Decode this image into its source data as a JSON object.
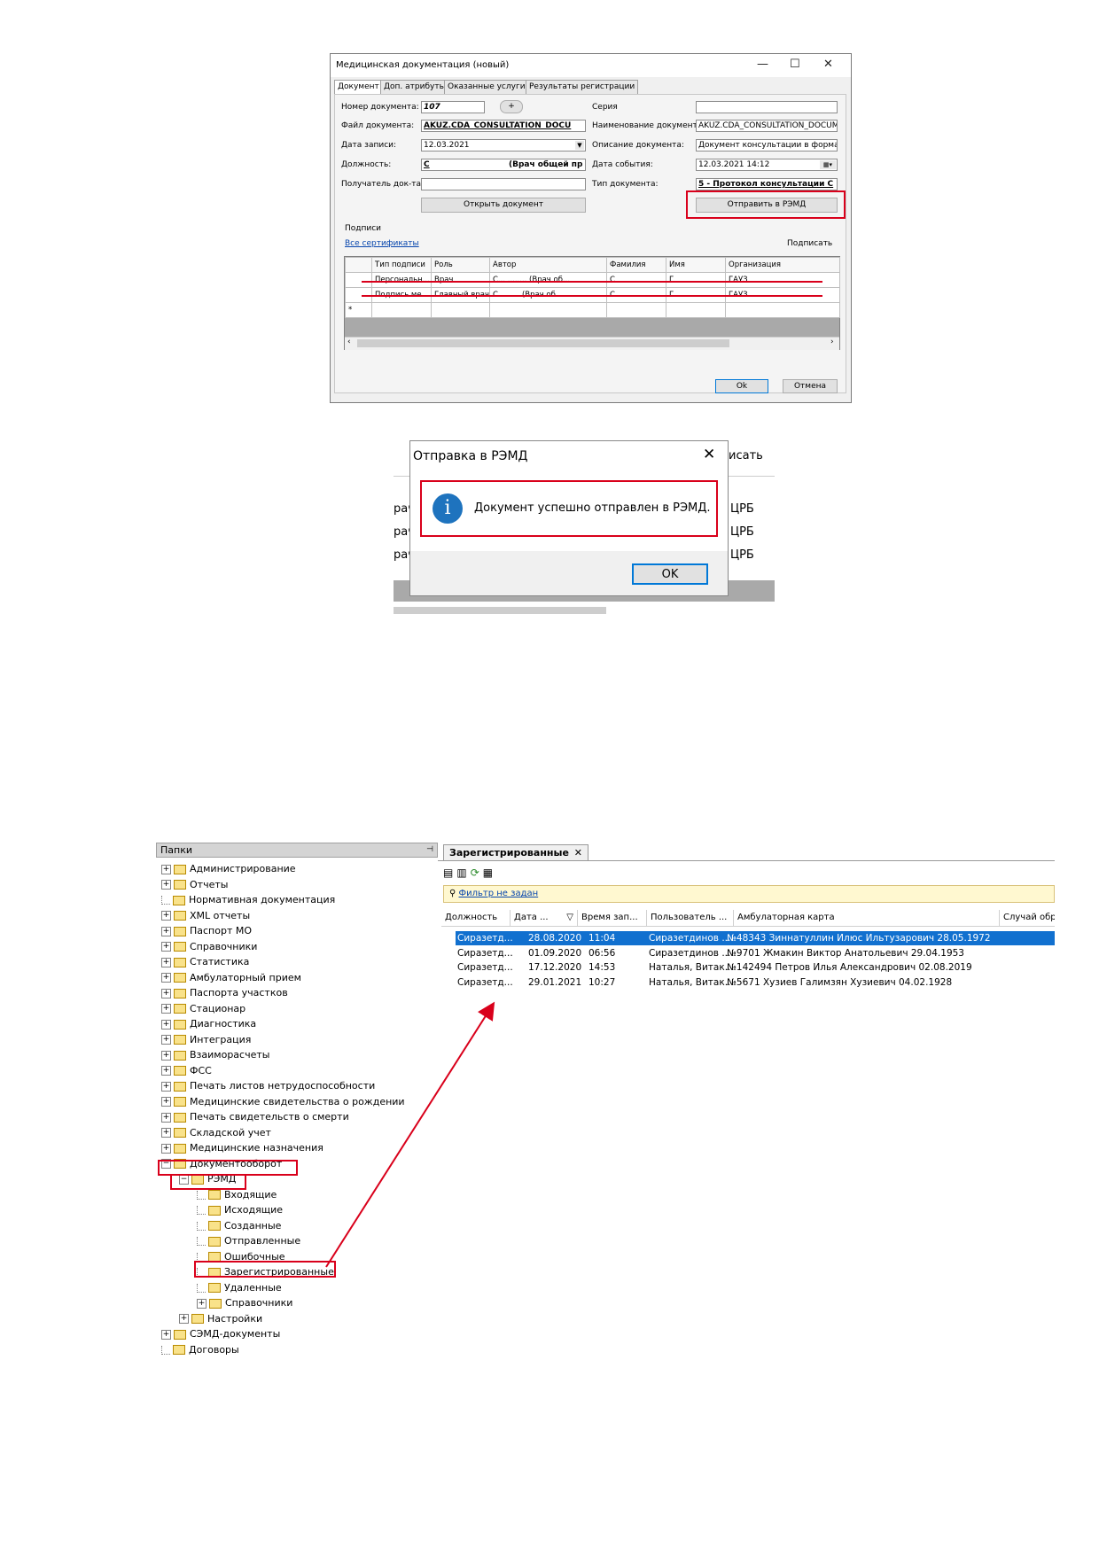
{
  "dialog1": {
    "title": "Медицинская документация (новый)",
    "tabs": [
      "Документ",
      "Доп. атрибуты",
      "Оказанные услуги",
      "Результаты регистрации"
    ],
    "labels": {
      "doc_number": "Номер документа:",
      "series": "Серия",
      "doc_file": "Файл документа:",
      "doc_name": "Наименование документа:",
      "record_date": "Дата записи:",
      "doc_description": "Описание документа:",
      "position": "Должность:",
      "event_date": "Дата события:",
      "recipient": "Получатель док-та",
      "doc_type": "Тип документа:",
      "signatures": "Подписи"
    },
    "values": {
      "doc_number": "107",
      "plus": "+",
      "doc_file": "AKUZ.CDA_CONSULTATION_DOCU",
      "doc_name": "AKUZ.CDA_CONSULTATION_DOCUM",
      "record_date": "12.03.2021",
      "doc_description": "Документ консультации в формате (",
      "position_prefix": "С",
      "position": "(Врач общей пр",
      "event_date": "12.03.2021 14:12",
      "doc_type": "5 - Протокол консультации С"
    },
    "buttons": {
      "open_doc": "Открыть документ",
      "send_remd": "Отправить в РЭМД",
      "ok": "Ok",
      "cancel": "Отмена"
    },
    "links": {
      "all_certs": "Все сертификаты",
      "sign": "Подписать"
    },
    "grid": {
      "headers": [
        "Тип подписи",
        "Роль",
        "Автор",
        "Фамилия",
        "Имя",
        "Организация"
      ],
      "rows": [
        [
          "Персональн...",
          "Врач",
          "С...  ........ (Врач об...",
          "С",
          "Г",
          "ГАУЗ"
        ],
        [
          "Подпись ме...",
          "Главный врач",
          "С ........ (Врач об...",
          "С",
          "Г",
          "ГАУЗ"
        ]
      ],
      "new_row_marker": "*"
    }
  },
  "dialog2": {
    "title": "Отправка в РЭМД",
    "message": "Документ успешно отправлен в РЭМД.",
    "ok": "OK",
    "bg_fragments": [
      "исать",
      "рач",
      "рач",
      "рач",
      "ЦРБ",
      "ЦРБ",
      "ЦРБ"
    ]
  },
  "tree": {
    "header": "Папки",
    "pin": "📌",
    "nodes": [
      {
        "label": "Администрирование",
        "level": 0,
        "exp": "+"
      },
      {
        "label": "Отчеты",
        "level": 0,
        "exp": "+"
      },
      {
        "label": "Нормативная документация",
        "level": 0,
        "exp": ""
      },
      {
        "label": "XML отчеты",
        "level": 0,
        "exp": "+"
      },
      {
        "label": "Паспорт МО",
        "level": 0,
        "exp": "+"
      },
      {
        "label": "Справочники",
        "level": 0,
        "exp": "+"
      },
      {
        "label": "Статистика",
        "level": 0,
        "exp": "+"
      },
      {
        "label": "Амбулаторный прием",
        "level": 0,
        "exp": "+"
      },
      {
        "label": "Паспорта участков",
        "level": 0,
        "exp": "+"
      },
      {
        "label": "Стационар",
        "level": 0,
        "exp": "+"
      },
      {
        "label": "Диагностика",
        "level": 0,
        "exp": "+"
      },
      {
        "label": "Интеграция",
        "level": 0,
        "exp": "+"
      },
      {
        "label": "Взаиморасчеты",
        "level": 0,
        "exp": "+"
      },
      {
        "label": "ФСС",
        "level": 0,
        "exp": "+"
      },
      {
        "label": "Печать листов нетрудоспособности",
        "level": 0,
        "exp": "+"
      },
      {
        "label": "Медицинские свидетельства о рождении",
        "level": 0,
        "exp": "+"
      },
      {
        "label": "Печать свидетельств о смерти",
        "level": 0,
        "exp": "+"
      },
      {
        "label": "Складской учет",
        "level": 0,
        "exp": "+"
      },
      {
        "label": "Медицинские назначения",
        "level": 0,
        "exp": "+"
      },
      {
        "label": "Документооборот",
        "level": 0,
        "exp": "−"
      },
      {
        "label": "РЭМД",
        "level": 1,
        "exp": "−"
      },
      {
        "label": "Входящие",
        "level": 2,
        "exp": ""
      },
      {
        "label": "Исходящие",
        "level": 2,
        "exp": ""
      },
      {
        "label": "Созданные",
        "level": 2,
        "exp": ""
      },
      {
        "label": "Отправленные",
        "level": 2,
        "exp": ""
      },
      {
        "label": "Ошибочные",
        "level": 2,
        "exp": ""
      },
      {
        "label": "Зарегистрированные",
        "level": 2,
        "exp": ""
      },
      {
        "label": "Удаленные",
        "level": 2,
        "exp": ""
      },
      {
        "label": "Справочники",
        "level": 2,
        "exp": "+"
      },
      {
        "label": "Настройки",
        "level": 1,
        "exp": "+"
      },
      {
        "label": "СЭМД-документы",
        "level": 0,
        "exp": "+"
      },
      {
        "label": "Договоры",
        "level": 0,
        "exp": ""
      }
    ]
  },
  "registry": {
    "tab_title": "Зарегистрированные",
    "tab_close": "✕",
    "filter": "Фильтр не задан",
    "columns": [
      "Должность",
      "Дата ...",
      "Время зап...",
      "Пользователь ...",
      "Амбулаторная карта",
      "Случай обр..."
    ],
    "rows": [
      {
        "position": "Сиразетд...",
        "date": "28.08.2020",
        "time": "11:04",
        "user": "Сиразетдинов ...",
        "card": "№48343 Зиннатуллин Илюс Ильтузарович 28.05.1972",
        "selected": true
      },
      {
        "position": "Сиразетд...",
        "date": "01.09.2020",
        "time": "06:56",
        "user": "Сиразетдинов ...",
        "card": "№9701 Жмакин Виктор Анатольевич 29.04.1953",
        "selected": false
      },
      {
        "position": "Сиразетд...",
        "date": "17.12.2020",
        "time": "14:53",
        "user": "Наталья, Витак...",
        "card": "№142494 Петров Илья Александрович 02.08.2019",
        "selected": false
      },
      {
        "position": "Сиразетд...",
        "date": "29.01.2021",
        "time": "10:27",
        "user": "Наталья, Витак...",
        "card": "№5671 Хузиев Галимзян Хузиевич 04.02.1928",
        "selected": false
      }
    ]
  },
  "colors": {
    "highlight": "#d9001b",
    "selection": "#1170cf",
    "info_icon": "#1e73be"
  },
  "icons": [
    "minimize-icon",
    "maximize-icon",
    "close-icon",
    "info-icon",
    "folder-icon",
    "pin-icon",
    "binoculars-icon",
    "refresh-icon"
  ]
}
